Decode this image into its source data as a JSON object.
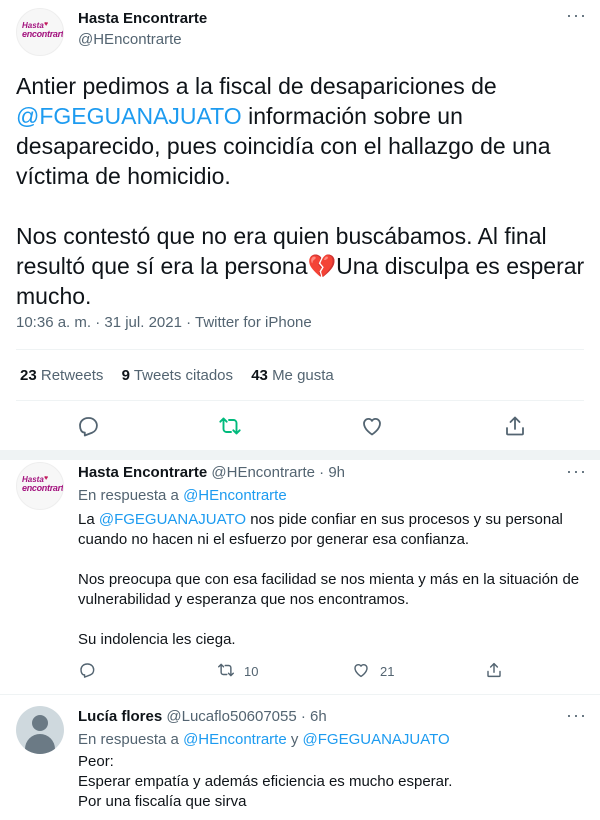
{
  "main_tweet": {
    "display_name": "Hasta Encontrarte",
    "handle": "@HEncontrarte",
    "avatar_text_top": "Hasta",
    "avatar_text_bottom": "encontrarte",
    "text_p1_a": "Antier pedimos a la fiscal de desapariciones de ",
    "text_p1_mention": "@FGEGUANAJUATO",
    "text_p1_b": " información sobre un desaparecido, pues coincidía con el hallazgo de una víctima de homicidio.",
    "text_p2_a": "Nos contestó que no era quien buscábamos. Al final resultó que sí era la persona",
    "text_p2_emoji": "💔",
    "text_p2_b": "Una disculpa es esperar mucho.",
    "meta": "10:36 a. m. · 31 jul. 2021 · Twitter for iPhone",
    "retweets_count": "23",
    "retweets_label": "Retweets",
    "quotes_count": "9",
    "quotes_label": "Tweets citados",
    "likes_count": "43",
    "likes_label": "Me gusta"
  },
  "reply1": {
    "display_name": "Hasta Encontrarte",
    "handle_time": "@HEncontrarte · 9h",
    "reply_to_label": "En respuesta a ",
    "reply_to_mention": "@HEncontrarte",
    "line1_a": "La ",
    "line1_mention": "@FGEGUANAJUATO",
    "line1_b": " nos pide confiar en sus procesos y su personal",
    "line2": "cuando no hacen ni el esfuerzo por generar esa confianza.",
    "line3": "Nos preocupa que con esa facilidad se nos mienta y más en la situación de",
    "line4": "vulnerabilidad y esperanza que nos encontramos.",
    "line5": "Su indolencia les ciega.",
    "retweet_count": "10",
    "like_count": "21"
  },
  "reply2": {
    "display_name": "Lucía flores",
    "handle_time": "@Lucaflo50607055 · 6h",
    "reply_to_label": "En respuesta a ",
    "reply_to_mention1": "@HEncontrarte",
    "reply_to_joiner": " y ",
    "reply_to_mention2": "@FGEGUANAJUATO",
    "line1": "Peor:",
    "line2": "Esperar empatía y además eficiencia es mucho esperar.",
    "line3": "Por una fiscalía que sirva"
  },
  "icons": {
    "reply": "reply-icon",
    "retweet": "retweet-icon",
    "like": "heart-icon",
    "share": "share-icon",
    "more": "more-icon"
  },
  "colors": {
    "link": "#1d9bf0",
    "retweet_active": "#00ba7c",
    "muted": "#536471",
    "brand": "#a3127e"
  }
}
